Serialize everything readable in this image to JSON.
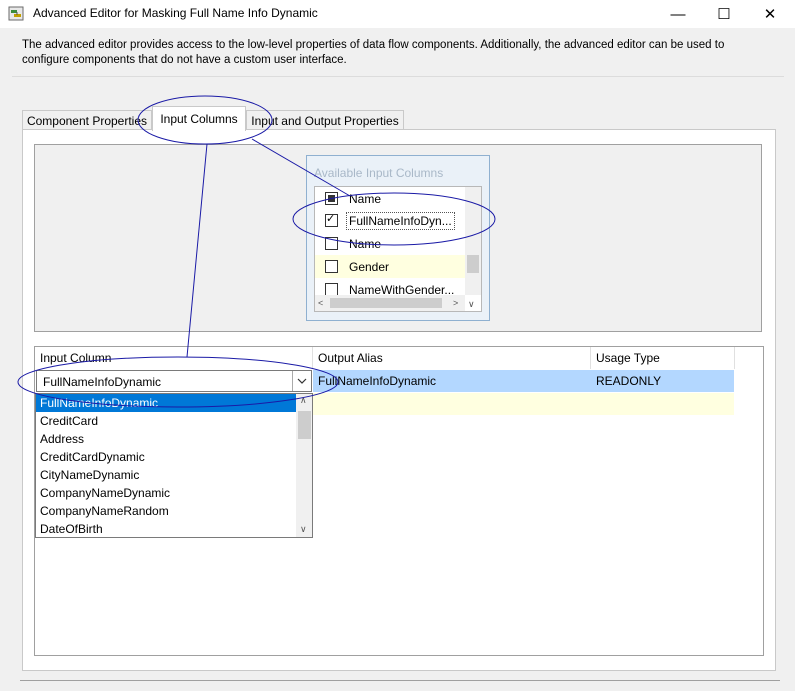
{
  "window": {
    "title": "Advanced Editor for Masking Full Name Info Dynamic",
    "minimize_glyph": "—",
    "maximize_glyph": "☐",
    "close_glyph": "✕"
  },
  "description": {
    "line1": "The advanced editor provides access to the low-level properties of data flow components. Additionally, the advanced editor can be used to",
    "line2": "configure components that do not have a custom user interface."
  },
  "tabs": [
    {
      "label": "Component Properties",
      "active": false
    },
    {
      "label": "Input Columns",
      "active": true
    },
    {
      "label": "Input and Output Properties",
      "active": false
    }
  ],
  "available_columns": {
    "title": "Available Input Columns",
    "items": [
      {
        "label": "Name",
        "state": "partial"
      },
      {
        "label": "FullNameInfoDyn...",
        "state": "checked"
      },
      {
        "label": "Name",
        "state": "unchecked"
      },
      {
        "label": "Gender",
        "state": "unchecked"
      },
      {
        "label": "NameWithGender...",
        "state": "unchecked"
      }
    ]
  },
  "grid": {
    "headers": [
      "Input Column",
      "Output Alias",
      "Usage Type"
    ],
    "rows": [
      {
        "input_column": "FullNameInfoDynamic",
        "output_alias": "FullNameInfoDynamic",
        "usage_type": "READONLY"
      }
    ]
  },
  "dropdown": {
    "selected": "FullNameInfoDynamic",
    "options": [
      "FullNameInfoDynamic",
      "CreditCard",
      "Address",
      "CreditCardDynamic",
      "CityNameDynamic",
      "CompanyNameDynamic",
      "CompanyNameRandom",
      "DateOfBirth"
    ]
  },
  "colors": {
    "selected_row": "#b3d7ff",
    "new_row": "#ffffe0",
    "list_selection": "#0078d7",
    "annotation": "#1a1aa6"
  }
}
